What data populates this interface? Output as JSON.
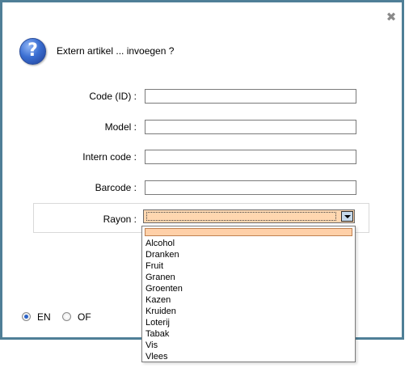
{
  "dialog": {
    "message": "Extern artikel ... invoegen ?"
  },
  "form": {
    "code_label": "Code (ID) :",
    "code_value": "",
    "model_label": "Model :",
    "model_value": "",
    "intern_label": "Intern code :",
    "intern_value": "",
    "barcode_label": "Barcode :",
    "barcode_value": "",
    "rayon_label": "Rayon :",
    "rayon_value": ""
  },
  "rayon_options": [
    "",
    "Alcohol",
    "Dranken",
    "Fruit",
    "Granen",
    "Groenten",
    "Kazen",
    "Kruiden",
    "Loterij",
    "Tabak",
    "Vis",
    "Vlees"
  ],
  "language": {
    "options": [
      "EN",
      "OF"
    ],
    "selected": "EN"
  },
  "colors": {
    "border": "#4f7f97",
    "selection": "#ffd0a8",
    "icon": "#3b6fd2"
  },
  "icons": {
    "close": "close-icon",
    "question": "question-icon",
    "dropdown": "chevron-down-icon"
  }
}
